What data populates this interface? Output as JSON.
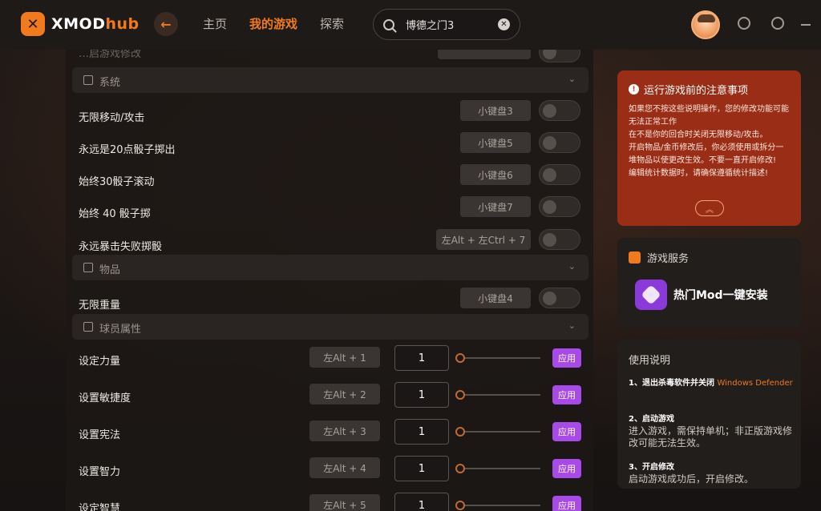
{
  "brand": {
    "name": "XMOD",
    "suffix": "hub",
    "accent": "#f07a1c"
  },
  "nav": {
    "items": [
      {
        "label": "主页"
      },
      {
        "label": "我的游戏",
        "active": true
      },
      {
        "label": "探索"
      }
    ]
  },
  "search": {
    "value": "博德之门3"
  },
  "list": {
    "clipped_top_label": "…启游戏修改",
    "sections": [
      {
        "label": "系统"
      },
      {
        "label": "物品"
      },
      {
        "label": "球员属性"
      }
    ],
    "toggle_rows": [
      {
        "label": "无限移动/攻击",
        "hotkey": "小键盘3",
        "enabled": false
      },
      {
        "label": "永远是20点骰子掷出",
        "hotkey": "小键盘5",
        "enabled": false
      },
      {
        "label": "始终30骰子滚动",
        "hotkey": "小键盘6",
        "enabled": false
      },
      {
        "label": "始终 40 骰子掷",
        "hotkey": "小键盘7",
        "enabled": false
      },
      {
        "label": "永远暴击失败掷骰",
        "hotkey": "左Alt + 左Ctrl + 7",
        "enabled": false
      },
      {
        "label": "无限重量",
        "hotkey": "小键盘4",
        "enabled": false
      }
    ],
    "value_rows": [
      {
        "label": "设定力量",
        "hotkey": "左Alt + 1",
        "value": "1",
        "apply": "应用"
      },
      {
        "label": "设置敏捷度",
        "hotkey": "左Alt + 2",
        "value": "1",
        "apply": "应用"
      },
      {
        "label": "设置宪法",
        "hotkey": "左Alt + 3",
        "value": "1",
        "apply": "应用"
      },
      {
        "label": "设置智力",
        "hotkey": "左Alt + 4",
        "value": "1",
        "apply": "应用"
      },
      {
        "label": "设定智慧",
        "hotkey": "左Alt + 5",
        "value": "1",
        "apply": "应用"
      }
    ]
  },
  "notice": {
    "title": "运行游戏前的注意事项",
    "lines": [
      "如果您不按这些说明操作，您的修改功能可能无法正常工作",
      "在不是你的回合时关闭无限移动/攻击。",
      "开启物品/金币修改后，你必须使用或拆分一堆物品以使更改生效。不要一直开启修改!",
      "编辑统计数据时，请确保遵循统计描述!"
    ],
    "color": "#9a2d15"
  },
  "services": {
    "title": "游戏服务",
    "item": "热门Mod一键安装"
  },
  "guide": {
    "title": "使用说明",
    "steps": [
      {
        "title": "1、退出杀毒软件并关闭",
        "highlight": "Windows Defender",
        "desc": ""
      },
      {
        "title": "2、启动游戏",
        "highlight": "",
        "desc": "进入游戏，需保持单机；非正版游戏修改可能无法生效。"
      },
      {
        "title": "3、开启修改",
        "highlight": "",
        "desc": "启动游戏成功后，开启修改。"
      }
    ]
  },
  "apply_color": "#a84ae8"
}
